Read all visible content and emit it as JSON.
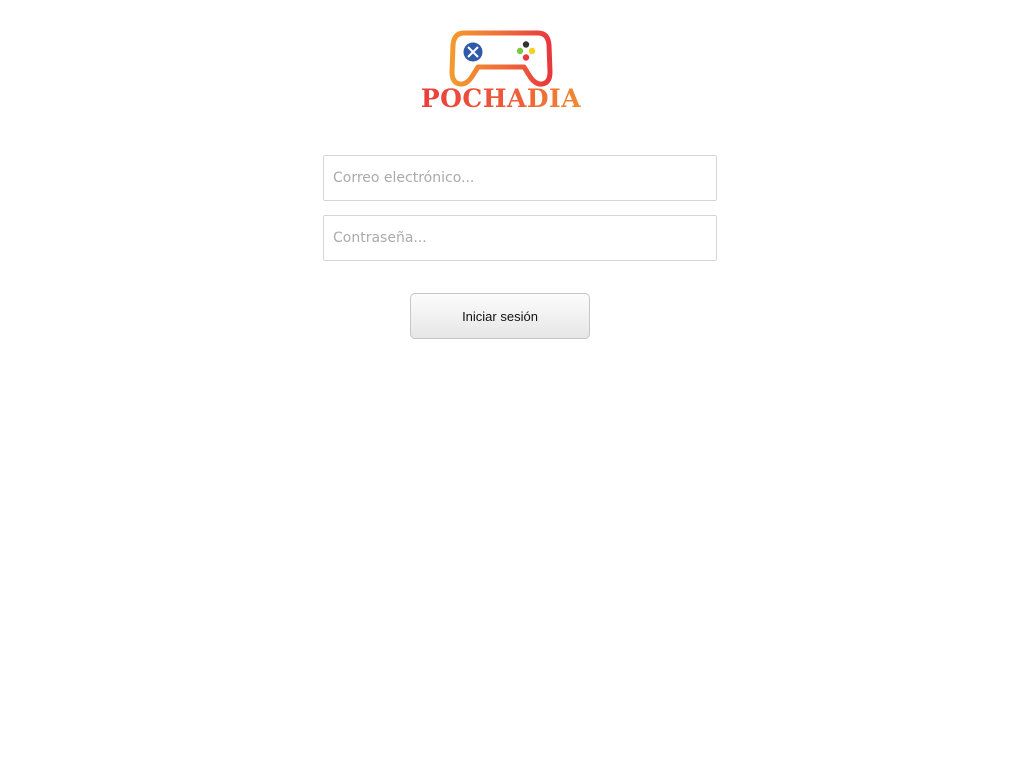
{
  "logo": {
    "text": "POCHADIA",
    "icon": "gamepad-icon",
    "colors": {
      "red": "#e8383d",
      "orange": "#f39a2e",
      "blue": "#2e5aa8",
      "green": "#7ac943",
      "yellow": "#f2d21a",
      "dark": "#333333"
    }
  },
  "login": {
    "email_placeholder": "Correo electrónico...",
    "password_placeholder": "Contraseña...",
    "submit_label": "Iniciar sesión"
  }
}
